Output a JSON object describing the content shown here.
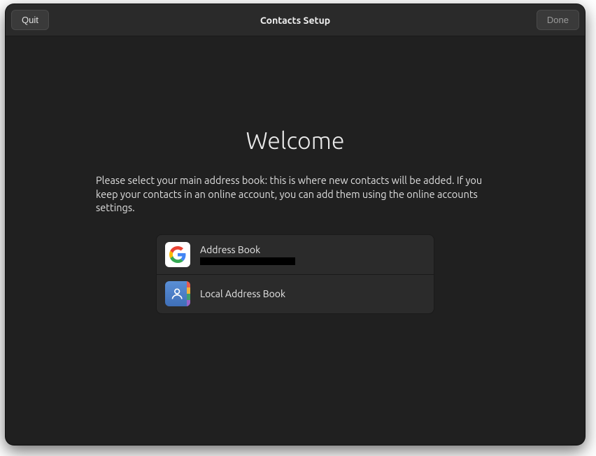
{
  "header": {
    "quit_label": "Quit",
    "title": "Contacts Setup",
    "done_label": "Done"
  },
  "main": {
    "heading": "Welcome",
    "description": "Please select your main address book: this is where new contacts will be added. If you keep your contacts in an online account, you can add them using the online accounts settings.",
    "options": [
      {
        "label": "Address Book",
        "icon": "google-icon",
        "has_sublabel": true
      },
      {
        "label": "Local Address Book",
        "icon": "addressbook-icon",
        "has_sublabel": false
      }
    ]
  }
}
